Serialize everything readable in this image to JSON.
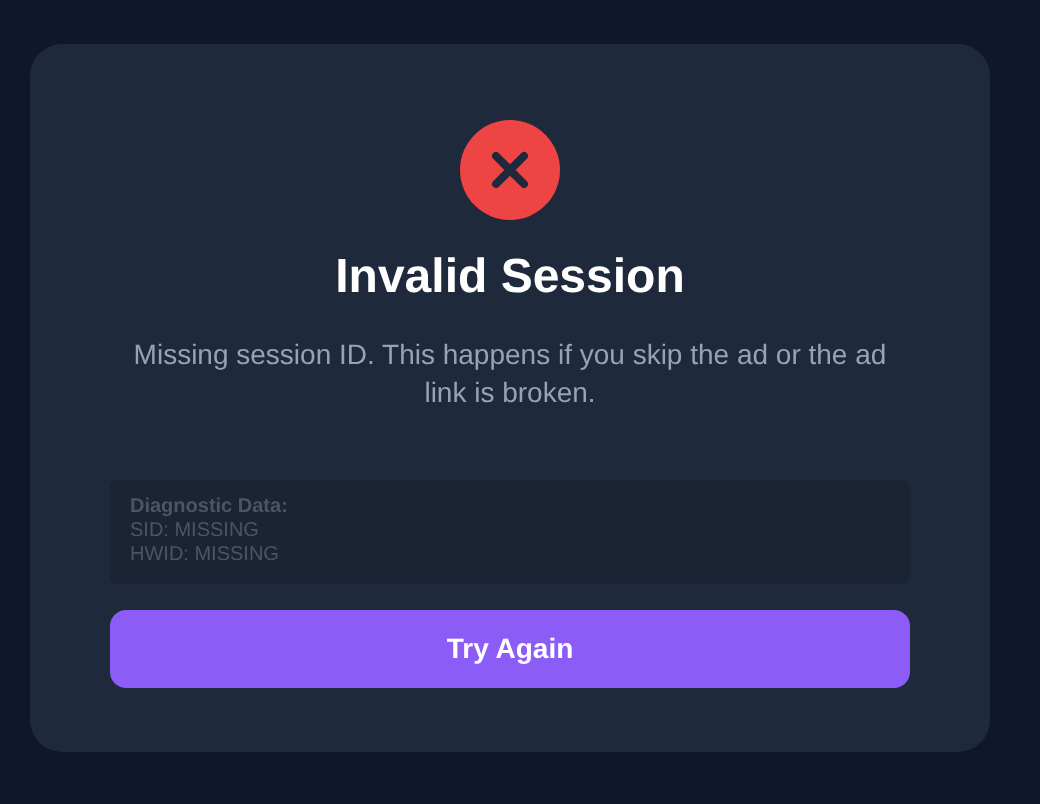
{
  "dialog": {
    "title": "Invalid Session",
    "message": "Missing session ID. This happens if you skip the ad or the ad link is broken.",
    "diagnostics": {
      "heading": "Diagnostic Data:",
      "lines": [
        "SID: MISSING",
        "HWID: MISSING"
      ]
    },
    "button": "Try Again"
  }
}
